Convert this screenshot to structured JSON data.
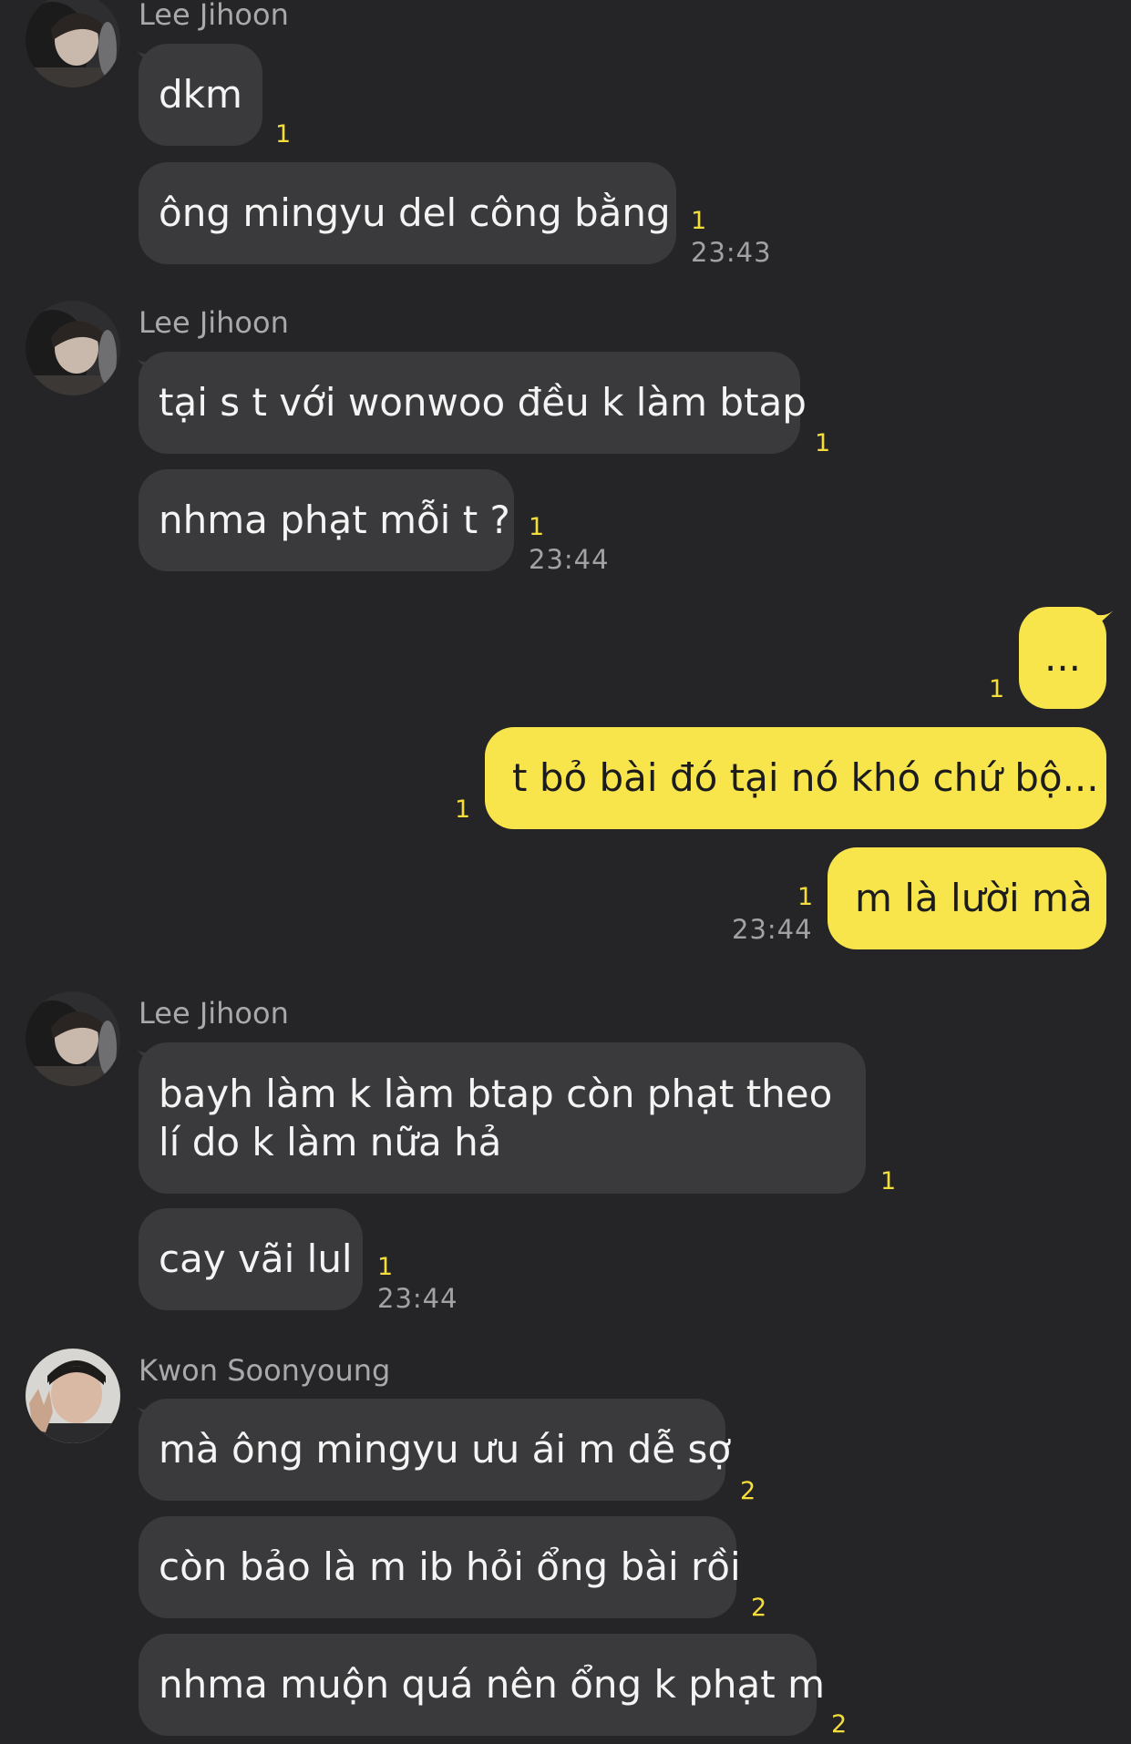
{
  "colors": {
    "background": "#252527",
    "incoming_bubble": "#3a3a3c",
    "outgoing_bubble": "#f8e44b",
    "unread_count": "#f5de3c"
  },
  "groups": [
    {
      "sender": "Lee Jihoon",
      "avatar_icon": "profile-photo-jihoon",
      "messages": [
        {
          "text": "dkm",
          "unread": "1"
        },
        {
          "text": "ông mingyu del công bằng",
          "unread": "1",
          "time": "23:43"
        }
      ]
    },
    {
      "sender": "Lee Jihoon",
      "avatar_icon": "profile-photo-jihoon",
      "messages": [
        {
          "text": "tại s t với wonwoo đều k làm btap",
          "unread": "1"
        },
        {
          "text": "nhma phạt mỗi t ?",
          "unread": "1",
          "time": "23:44"
        }
      ]
    },
    {
      "sender": "me",
      "messages": [
        {
          "text": "...",
          "unread": "1"
        },
        {
          "text": "t bỏ bài đó tại nó khó chứ bộ...",
          "unread": "1"
        },
        {
          "text": "m là lười mà",
          "unread": "1",
          "time": "23:44"
        }
      ]
    },
    {
      "sender": "Lee Jihoon",
      "avatar_icon": "profile-photo-jihoon",
      "messages": [
        {
          "text": "bayh làm k làm btap còn phạt theo lí do k làm nữa hả",
          "unread": "1"
        },
        {
          "text": "cay vãi lul",
          "unread": "1",
          "time": "23:44"
        }
      ]
    },
    {
      "sender": "Kwon Soonyoung",
      "avatar_icon": "profile-photo-soonyoung",
      "messages": [
        {
          "text": "mà ông mingyu ưu ái m dễ sợ",
          "unread": "2"
        },
        {
          "text": "còn bảo là m ib hỏi ổng bài rồi",
          "unread": "2"
        },
        {
          "text": "nhma muộn quá nên ổng k phạt m",
          "unread": "2"
        }
      ]
    }
  ]
}
